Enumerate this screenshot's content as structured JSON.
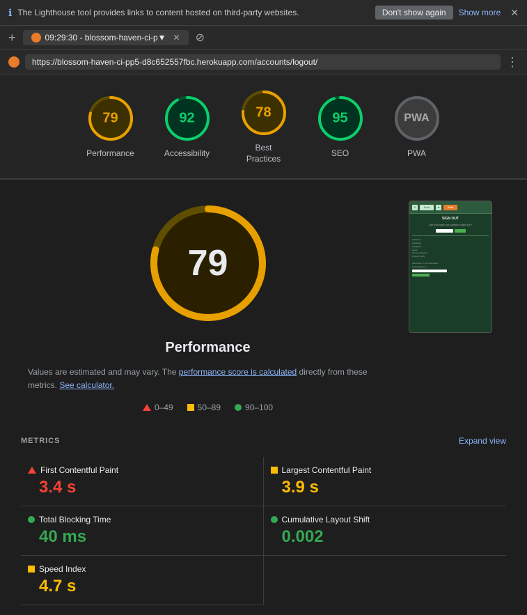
{
  "banner": {
    "text": "The Lighthouse tool provides links to content hosted on third-party websites.",
    "dont_show_label": "Don't show again",
    "show_more_label": "Show more",
    "close_symbol": "✕"
  },
  "tab": {
    "time": "09:29:30",
    "title": "blossom-haven-ci-p▼",
    "blocked_symbol": "⊘"
  },
  "url_bar": {
    "url": "https://blossom-haven-ci-pp5-d8c652557fbc.herokuapp.com/accounts/logout/",
    "menu_symbol": "⋮"
  },
  "scores": [
    {
      "id": "performance",
      "value": 79,
      "label": "Performance",
      "color": "#e8a000",
      "bg_color": "#3d3000",
      "ring_color": "#e8a000"
    },
    {
      "id": "accessibility",
      "value": 92,
      "label": "Accessibility",
      "color": "#0cce6b",
      "bg_color": "#003320",
      "ring_color": "#0cce6b"
    },
    {
      "id": "best-practices",
      "value": 78,
      "label": "Best\nPractices",
      "color": "#e8a000",
      "bg_color": "#3d3000",
      "ring_color": "#e8a000"
    },
    {
      "id": "seo",
      "value": 95,
      "label": "SEO",
      "color": "#0cce6b",
      "bg_color": "#003320",
      "ring_color": "#0cce6b"
    },
    {
      "id": "pwa",
      "value": "–",
      "label": "PWA",
      "color": "#aaa",
      "bg_color": "#3c3c3c",
      "ring_color": "#5f6368"
    }
  ],
  "performance": {
    "score": 79,
    "title": "Performance",
    "desc_part1": "Values are estimated and may vary. The ",
    "desc_link1": "performance score is calculated",
    "desc_part2": " directly from these metrics. ",
    "desc_link2": "See calculator.",
    "ranges": [
      {
        "label": "0–49",
        "type": "red"
      },
      {
        "label": "50–89",
        "type": "yellow"
      },
      {
        "label": "90–100",
        "type": "green"
      }
    ]
  },
  "metrics": {
    "title": "METRICS",
    "expand_label": "Expand view",
    "items": [
      {
        "id": "fcp",
        "name": "First Contentful Paint",
        "value": "3.4 s",
        "type": "red"
      },
      {
        "id": "lcp",
        "name": "Largest Contentful Paint",
        "value": "3.9 s",
        "type": "yellow"
      },
      {
        "id": "tbt",
        "name": "Total Blocking Time",
        "value": "40 ms",
        "type": "green"
      },
      {
        "id": "cls",
        "name": "Cumulative Layout Shift",
        "value": "0.002",
        "type": "green"
      },
      {
        "id": "si",
        "name": "Speed Index",
        "value": "4.7 s",
        "type": "yellow"
      }
    ]
  }
}
